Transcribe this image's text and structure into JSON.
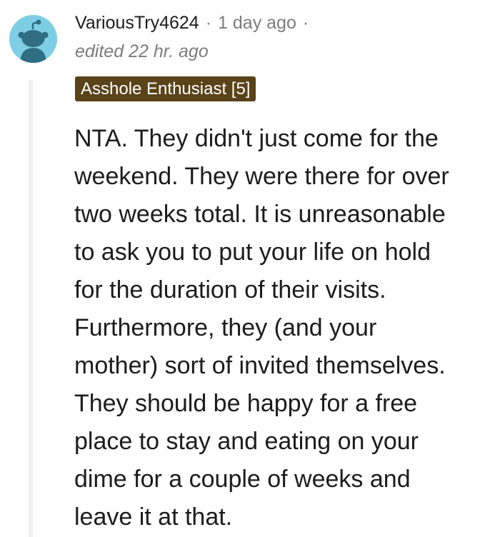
{
  "comment": {
    "username": "VariousTry4624",
    "separator": "·",
    "timestamp": "1 day ago",
    "edited": "edited 22 hr. ago",
    "flair": "Asshole Enthusiast [5]",
    "flair_color": "#5a4319",
    "avatar_color": "#7ecfe6",
    "avatar_icon": "reddit-snoo-icon",
    "body": "NTA. They didn't just come for the\nweekend. They were there for over\ntwo weeks total. It is unreasonable\nto ask you to put your life on hold\nfor the duration of their visits.\nFurthermore, they (and your\nmother) sort of invited themselves.\nThey should be happy for a free\nplace to stay and eating on your\ndime for a couple of weeks and\nleave it at that."
  }
}
